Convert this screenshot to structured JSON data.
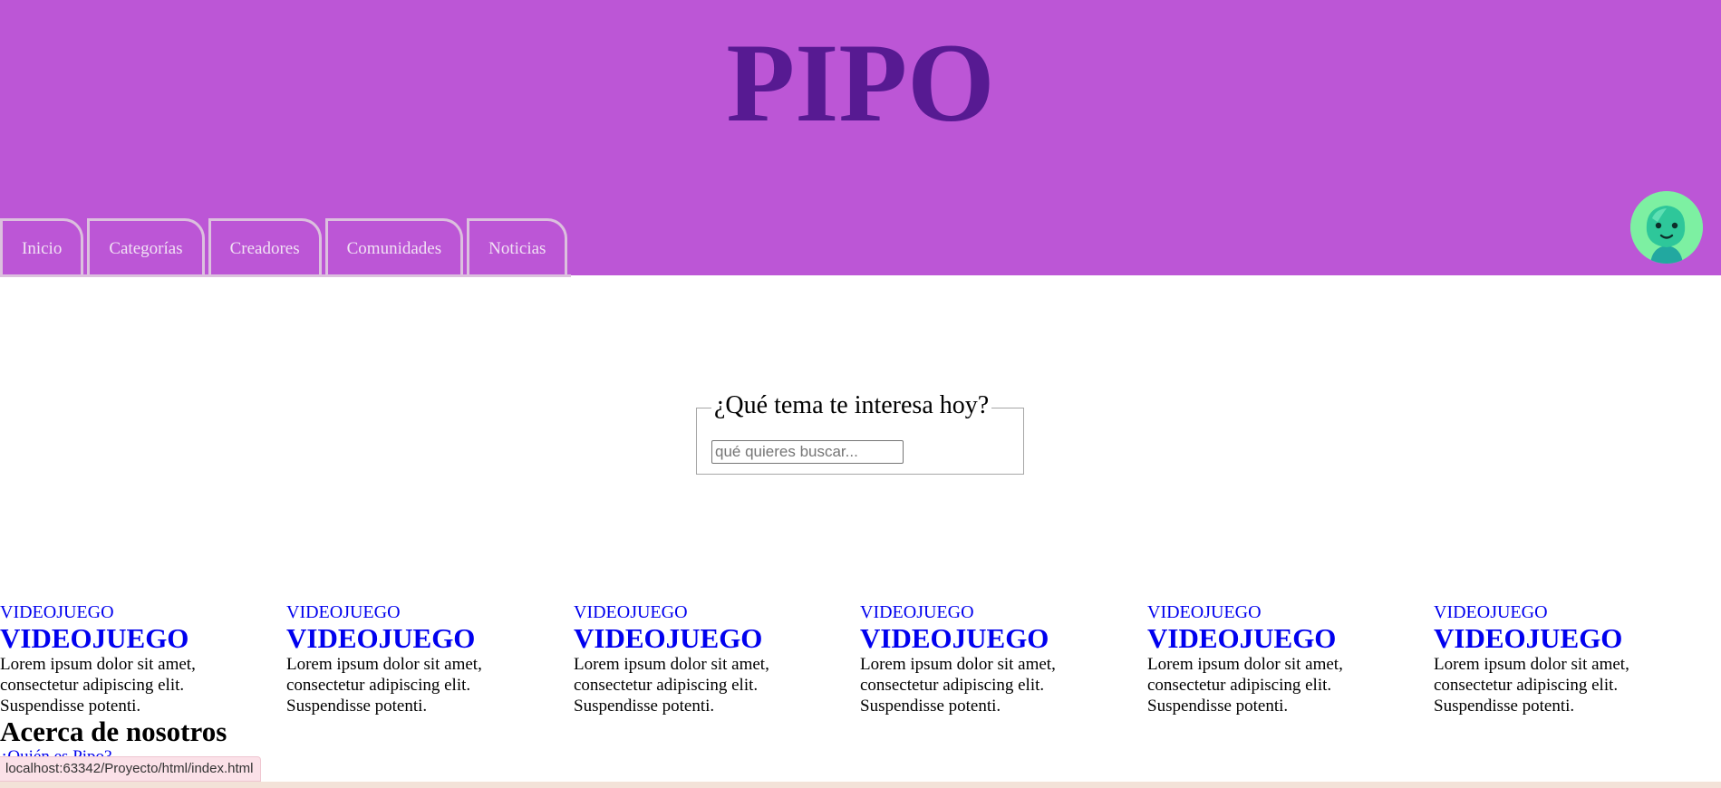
{
  "header": {
    "title": "PIPO",
    "colors": {
      "background": "#bc56d6",
      "title": "#571a92",
      "tab_border": "#dcc0de"
    },
    "nav": [
      {
        "label": "Inicio"
      },
      {
        "label": "Categorías"
      },
      {
        "label": "Creadores"
      },
      {
        "label": "Comunidades"
      },
      {
        "label": "Noticias"
      }
    ],
    "avatar_icon": "green-smiling-creature-avatar-icon"
  },
  "search": {
    "legend": "¿Qué tema te interesa hoy?",
    "placeholder": "qué quieres buscar...",
    "value": ""
  },
  "cards": [
    {
      "image_alt": "VIDEOJUEGO",
      "title": "VIDEOJUEGO",
      "text": "Lorem ipsum dolor sit amet, consectetur adipiscing elit. Suspendisse potenti."
    },
    {
      "image_alt": "VIDEOJUEGO",
      "title": "VIDEOJUEGO",
      "text": "Lorem ipsum dolor sit amet, consectetur adipiscing elit. Suspendisse potenti."
    },
    {
      "image_alt": "VIDEOJUEGO",
      "title": "VIDEOJUEGO",
      "text": "Lorem ipsum dolor sit amet, consectetur adipiscing elit. Suspendisse potenti."
    },
    {
      "image_alt": "VIDEOJUEGO",
      "title": "VIDEOJUEGO",
      "text": "Lorem ipsum dolor sit amet, consectetur adipiscing elit. Suspendisse potenti."
    },
    {
      "image_alt": "VIDEOJUEGO",
      "title": "VIDEOJUEGO",
      "text": "Lorem ipsum dolor sit amet, consectetur adipiscing elit. Suspendisse potenti."
    },
    {
      "image_alt": "VIDEOJUEGO",
      "title": "VIDEOJUEGO",
      "text": "Lorem ipsum dolor sit amet, consectetur adipiscing elit. Suspendisse potenti."
    }
  ],
  "about": {
    "title": "Acerca de nosotros",
    "link": "¿Quién es Pipo?"
  },
  "status_bar": {
    "url": "localhost:63342/Proyecto/html/index.html"
  }
}
